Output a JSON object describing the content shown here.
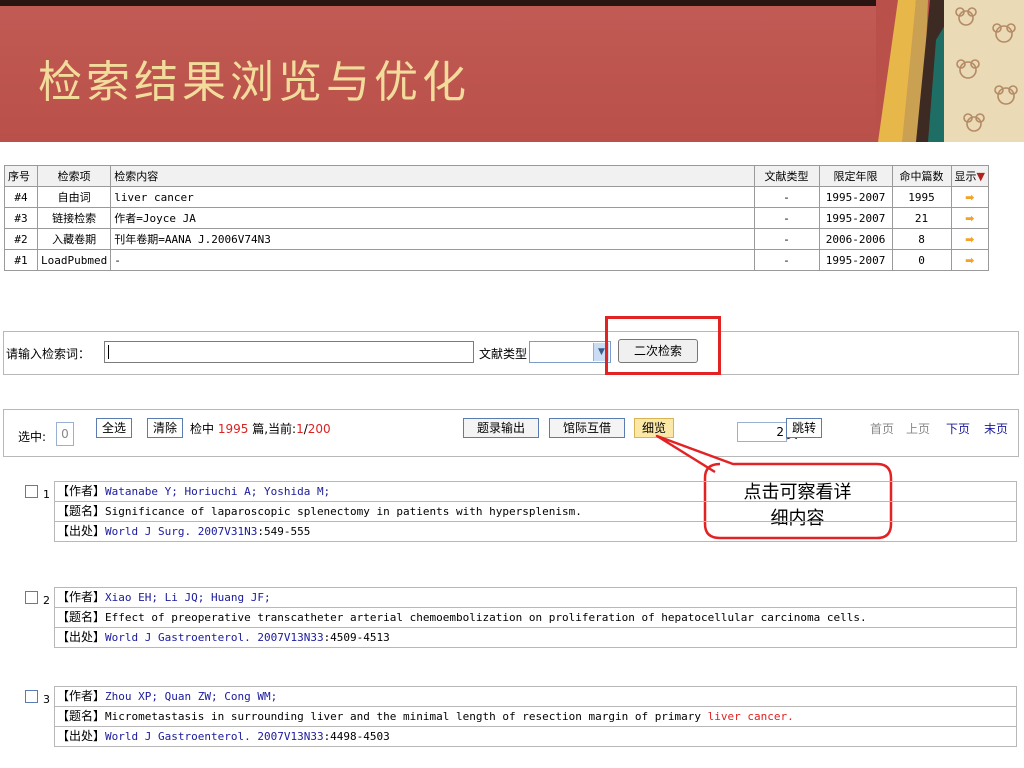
{
  "header": {
    "title": "检索结果浏览与优化"
  },
  "history": {
    "columns": [
      "序号",
      "检索项",
      "检索内容",
      "文献类型",
      "限定年限",
      "命中篇数",
      "显示"
    ],
    "sort_icon": "triangle-down-icon",
    "rows": [
      {
        "id": "#4",
        "field": "自由词",
        "content": "liver cancer",
        "type": "-",
        "years": "1995-2007",
        "hits": "1995",
        "show": "➡"
      },
      {
        "id": "#3",
        "field": "链接检索",
        "content": "作者=Joyce JA",
        "type": "-",
        "years": "1995-2007",
        "hits": "21",
        "show": "➡"
      },
      {
        "id": "#2",
        "field": "入藏卷期",
        "content": "刊年卷期=AANA J.2006V74N3",
        "type": "-",
        "years": "2006-2006",
        "hits": "8",
        "show": "➡"
      },
      {
        "id": "#1",
        "field": "LoadPubmed",
        "content": "-",
        "type": "-",
        "years": "1995-2007",
        "hits": "0",
        "show": "➡"
      }
    ]
  },
  "search": {
    "label": "请输入检索词：",
    "input_value": "",
    "doc_type_label": "文献类型",
    "doc_type_value": "",
    "secondary_button": "二次检索"
  },
  "toolbar": {
    "selected_label": "选中:",
    "selected_count": "0",
    "select_all": "全选",
    "clear": "清除",
    "hits_prefix": "检中",
    "hits_count": "1995",
    "hits_suffix": "篇,当前:",
    "current_page": "1",
    "page_sep": "/",
    "total_pages": "200",
    "export": "题录输出",
    "ill": "馆际互借",
    "detail": "细览",
    "page_input": "2",
    "page_unit": "页",
    "jump": "跳转",
    "first": "首页",
    "prev": "上页",
    "next": "下页",
    "last": "末页"
  },
  "callout": {
    "line1": "点击可察看详",
    "line2": "细内容"
  },
  "tags": {
    "author": "【作者】",
    "title": "【题名】",
    "source": "【出处】"
  },
  "records": [
    {
      "num": "1",
      "authors": "Watanabe Y; Horiuchi A; Yoshida M;",
      "title": "Significance of laparoscopic splenectomy in patients with hypersplenism.",
      "title_highlight": "",
      "source_link": "World J Surg. 2007V31N3",
      "source_pages": ":549-555"
    },
    {
      "num": "2",
      "authors": "Xiao EH; Li JQ; Huang JF;",
      "title": "Effect of preoperative transcatheter arterial chemoembolization on proliferation of hepatocellular carcinoma cells.",
      "title_highlight": "",
      "source_link": "World J Gastroenterol. 2007V13N33",
      "source_pages": ":4509-4513"
    },
    {
      "num": "3",
      "authors": "Zhou XP; Quan ZW; Cong WM;",
      "title": "Micrometastasis in surrounding liver and the minimal length of resection margin of primary ",
      "title_highlight": "liver cancer.",
      "source_link": "World J Gastroenterol. 2007V13N33",
      "source_pages": ":4498-4503"
    }
  ],
  "colors": {
    "header_bg": "#c0574f",
    "title_text": "#f2dc9c",
    "callout_border": "#e32224",
    "link": "#1a1a9c",
    "highlight": "#d22222"
  }
}
